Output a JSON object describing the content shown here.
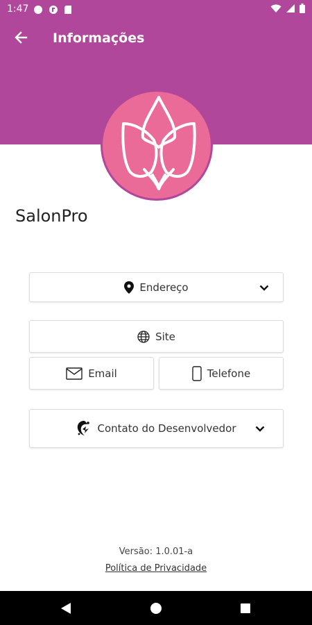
{
  "status_bar": {
    "time": "1:47",
    "icons": [
      "notification-dot-icon",
      "app-notification-icon",
      "sd-card-icon",
      "wifi-icon",
      "signal-icon",
      "battery-icon"
    ]
  },
  "app_bar": {
    "title": "Informações",
    "back_icon": "arrow-back-icon",
    "color": "#b0479a"
  },
  "logo": {
    "icon": "lotus-flower-icon",
    "color": "#ea6b97"
  },
  "salon": {
    "name": "SalonPro"
  },
  "cards": {
    "address": {
      "label": "Endereço",
      "icon": "location-pin-icon",
      "expand_icon": "chevron-down-icon"
    },
    "site": {
      "label": "Site",
      "icon": "globe-icon"
    },
    "email": {
      "label": "Email",
      "icon": "envelope-icon"
    },
    "phone": {
      "label": "Telefone",
      "icon": "phone-icon"
    },
    "developer": {
      "label": "Contato do Desenvolvedor",
      "icon": "developer-logo-icon",
      "expand_icon": "chevron-down-icon"
    }
  },
  "footer": {
    "version": "Versão: 1.0.01-a",
    "privacy": "Política de Privacidade"
  },
  "nav_bar": {
    "icons": [
      "back-triangle-icon",
      "home-circle-icon",
      "recents-square-icon"
    ]
  }
}
